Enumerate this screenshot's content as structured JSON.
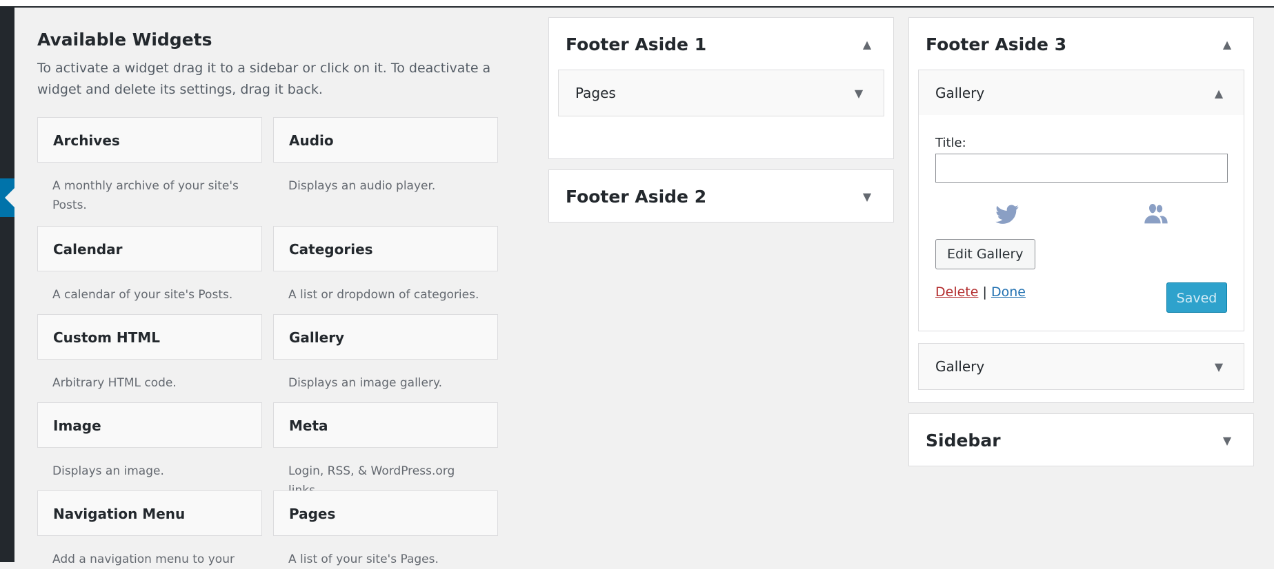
{
  "available": {
    "title": "Available Widgets",
    "description": "To activate a widget drag it to a sidebar or click on it. To deactivate a widget and delete its settings, drag it back."
  },
  "widgets": [
    {
      "title": "Archives",
      "desc": "A monthly archive of your site's Posts."
    },
    {
      "title": "Audio",
      "desc": "Displays an audio player."
    },
    {
      "title": "Calendar",
      "desc": "A calendar of your site's Posts."
    },
    {
      "title": "Categories",
      "desc": "A list or dropdown of categories."
    },
    {
      "title": "Custom HTML",
      "desc": "Arbitrary HTML code."
    },
    {
      "title": "Gallery",
      "desc": "Displays an image gallery."
    },
    {
      "title": "Image",
      "desc": "Displays an image."
    },
    {
      "title": "Meta",
      "desc": "Login, RSS, & WordPress.org links."
    },
    {
      "title": "Navigation Menu",
      "desc": "Add a navigation menu to your"
    },
    {
      "title": "Pages",
      "desc": "A list of your site's Pages."
    }
  ],
  "sidebars": {
    "footer1": {
      "title": "Footer Aside 1",
      "widget": "Pages"
    },
    "footer2": {
      "title": "Footer Aside 2"
    },
    "footer3": {
      "title": "Footer Aside 3",
      "open_widget": {
        "title": "Gallery",
        "title_label": "Title:",
        "title_value": "",
        "edit_button": "Edit Gallery",
        "delete_link": "Delete",
        "separator": "|",
        "done_link": "Done",
        "saved_button": "Saved"
      },
      "second_widget": "Gallery"
    },
    "sidebar": {
      "title": "Sidebar"
    }
  },
  "icons": {
    "collapse": "▲",
    "expand": "▼"
  },
  "colors": {
    "accent": "#0073aa",
    "saved_button": "#2ea2cc",
    "delete_link": "#b32d2e",
    "done_link": "#2271b1"
  }
}
